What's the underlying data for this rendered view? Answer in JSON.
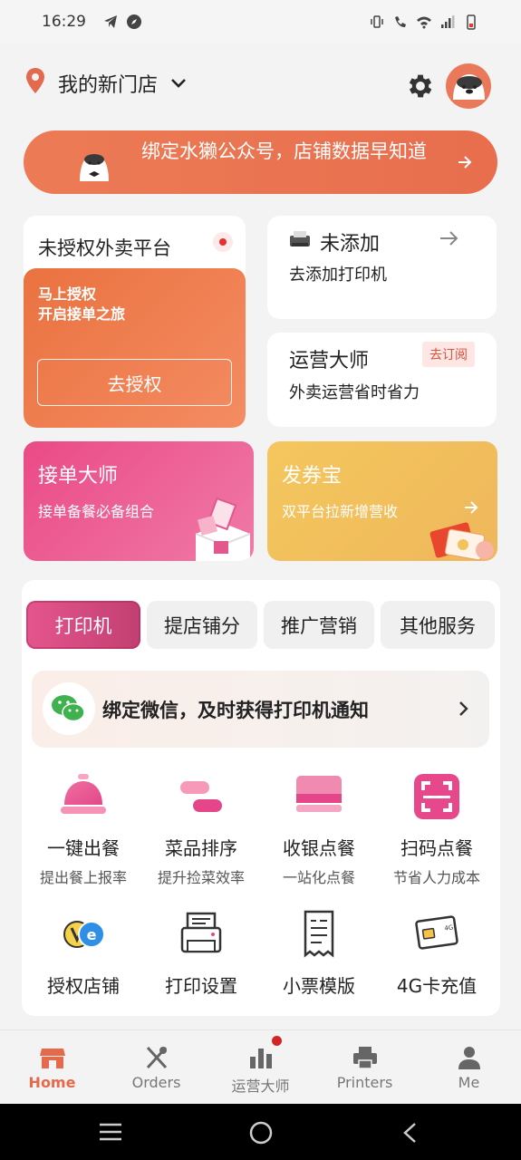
{
  "status_bar": {
    "time": "16:29"
  },
  "header": {
    "store_name": "我的新门店"
  },
  "bind_banner": {
    "text": "绑定水獭公众号，店铺数据早知道"
  },
  "unauth_card": {
    "title": "未授权外卖平台",
    "line1": "马上授权",
    "line2": "开启接单之旅",
    "button": "去授权"
  },
  "printer_card": {
    "title": "未添加",
    "subtitle": "去添加打印机"
  },
  "ops_card": {
    "title": "运营大师",
    "badge": "去订阅",
    "subtitle": "外卖运营省时省力"
  },
  "promo_jd": {
    "title": "接单大师",
    "subtitle": "接单备餐必备组合"
  },
  "promo_fq": {
    "title": "发券宝",
    "subtitle": "双平台拉新增营收"
  },
  "tabs": [
    {
      "label": "打印机"
    },
    {
      "label": "提店铺分"
    },
    {
      "label": "推广营销"
    },
    {
      "label": "其他服务"
    }
  ],
  "wechat_banner": {
    "text": "绑定微信，及时获得打印机通知"
  },
  "grid": [
    {
      "title": "一键出餐",
      "subtitle": "提出餐上报率",
      "icon": "bell-icon"
    },
    {
      "title": "菜品排序",
      "subtitle": "提升捡菜效率",
      "icon": "sort-icon"
    },
    {
      "title": "收银点餐",
      "subtitle": "一站化点餐",
      "icon": "cashier-icon"
    },
    {
      "title": "扫码点餐",
      "subtitle": "节省人力成本",
      "icon": "scan-icon"
    },
    {
      "title": "授权店铺",
      "icon": "platform-logo-icon"
    },
    {
      "title": "打印设置",
      "icon": "printer-settings-icon"
    },
    {
      "title": "小票模版",
      "icon": "receipt-icon"
    },
    {
      "title": "4G卡充值",
      "icon": "sim-card-icon"
    }
  ],
  "bottom_nav": [
    {
      "label": "Home",
      "active": true
    },
    {
      "label": "Orders"
    },
    {
      "label": "运营大师",
      "badge": true
    },
    {
      "label": "Printers"
    },
    {
      "label": "Me"
    }
  ],
  "colors": {
    "accent": "#e5694a",
    "pink": "#e4568d",
    "banner": "#ea7650"
  }
}
